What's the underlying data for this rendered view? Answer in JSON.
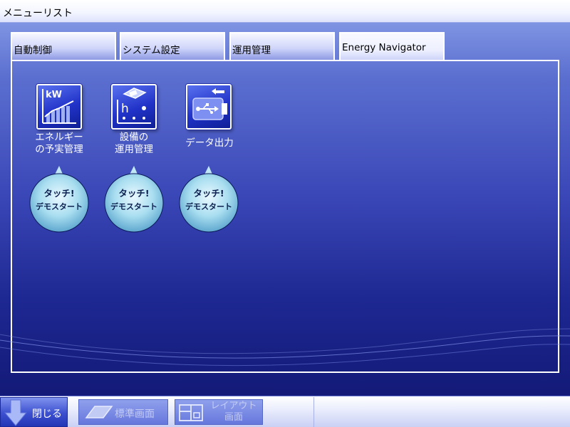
{
  "window": {
    "title": "メニューリスト"
  },
  "tabs": [
    {
      "label": "自動制御",
      "active": false
    },
    {
      "label": "システム設定",
      "active": false
    },
    {
      "label": "運用管理",
      "active": false
    },
    {
      "label": "Energy Navigator",
      "active": true
    }
  ],
  "apps": [
    {
      "label_line1": "エネルギー",
      "label_line2": "の予実管理",
      "icon": "energy-kw-chart-icon"
    },
    {
      "label_line1": "設備の",
      "label_line2": "運用管理",
      "icon": "equipment-operation-icon"
    },
    {
      "label_line1": "データ出力",
      "label_line2": "",
      "icon": "usb-export-icon"
    }
  ],
  "demo_bubble": {
    "line1": "タッチ!",
    "line2": "デモスタート"
  },
  "footer": {
    "close_label": "閉じる",
    "standard_screen_label": "標準画面",
    "layout_screen_label_line1": "レイアウト",
    "layout_screen_label_line2": "画面"
  },
  "colors": {
    "accent": "#2133c8",
    "background_top": "#8ea4ea",
    "background_bottom": "#131a78",
    "bubble": "#8fd4ea",
    "text_on_dark": "#ffffff"
  }
}
